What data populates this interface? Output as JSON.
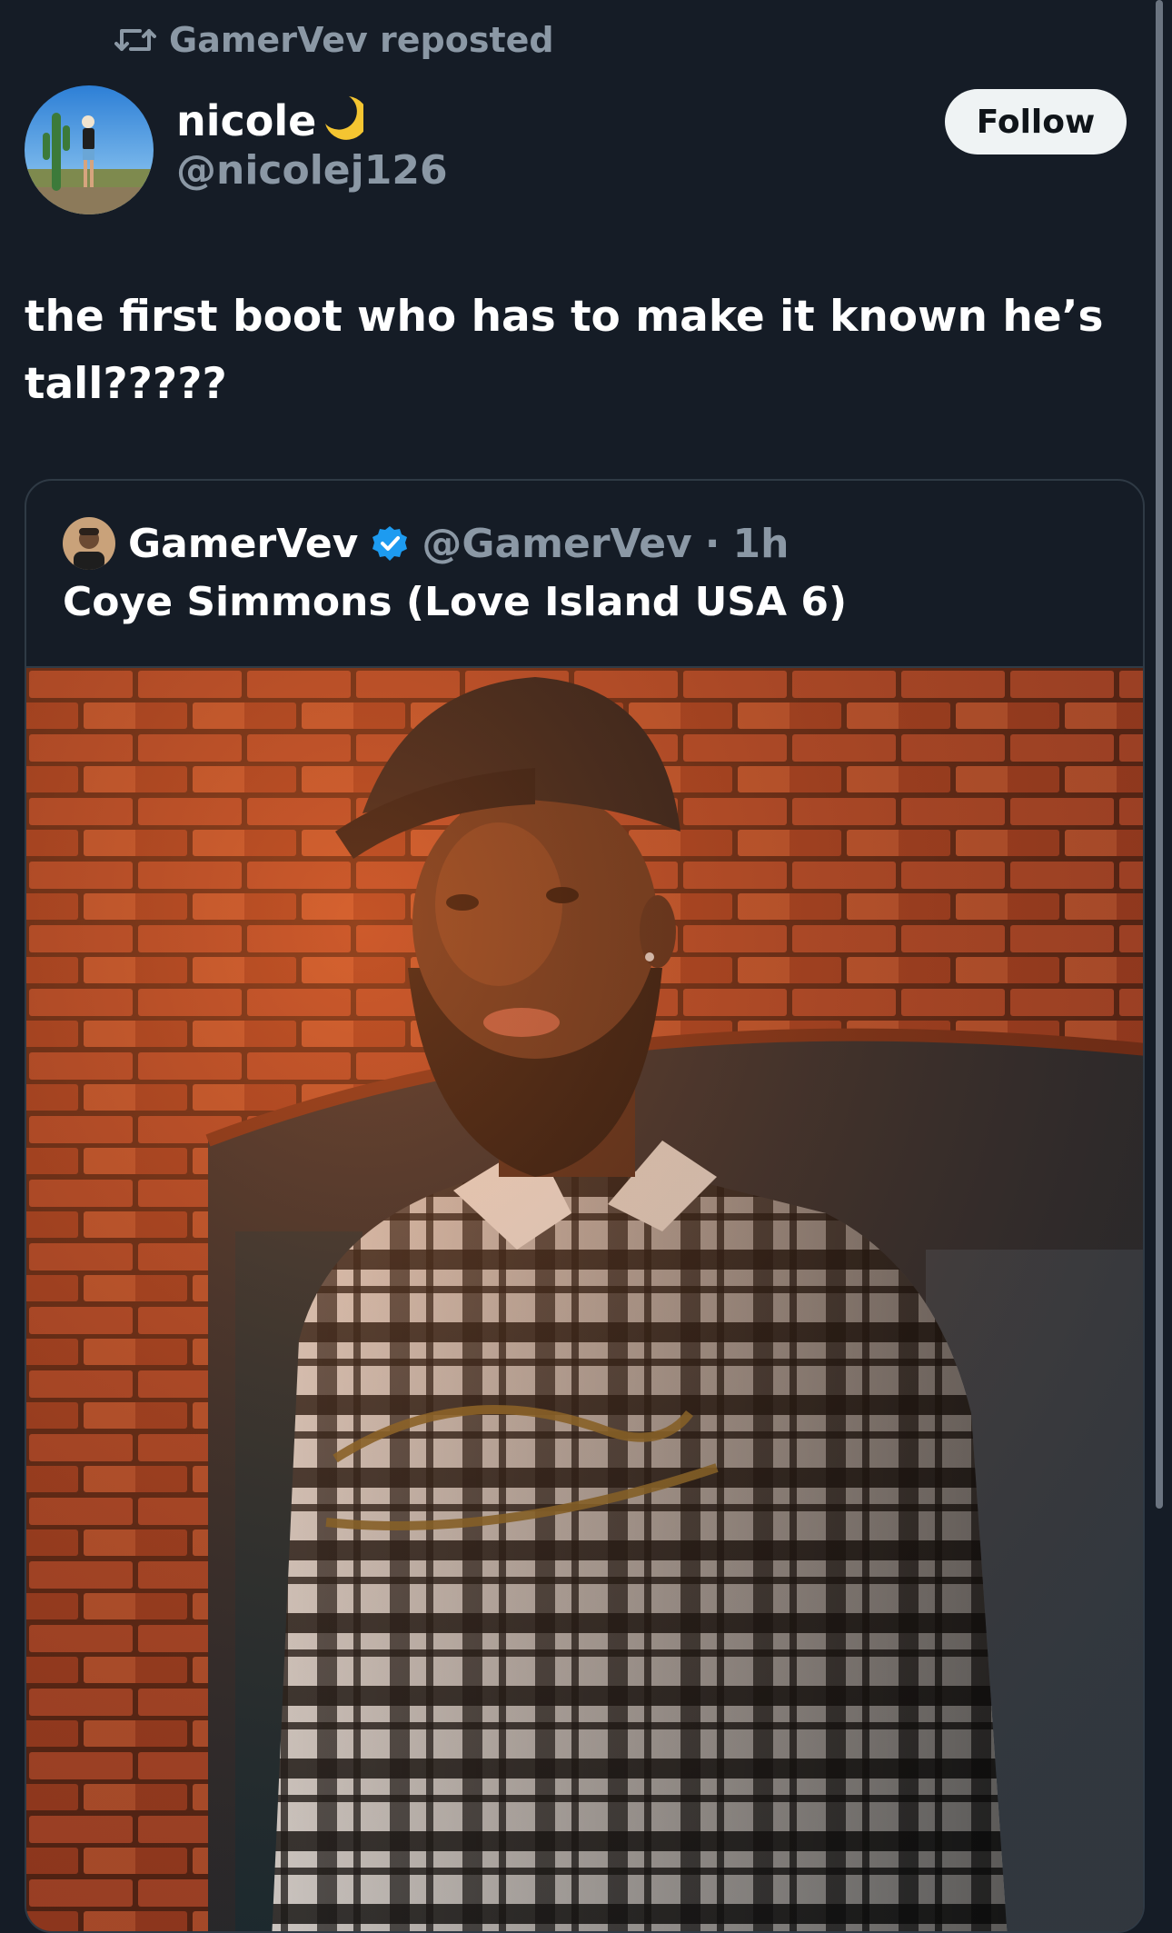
{
  "repost": {
    "label": "GamerVev reposted",
    "icon": "repost-icon"
  },
  "post": {
    "author": {
      "display_name": "nicole",
      "emoji": "🌙",
      "handle": "@nicolej126"
    },
    "follow_label": "Follow",
    "text": "the first boot who has to make it known he’s tall?????"
  },
  "quoted_post": {
    "author": {
      "display_name": "GamerVev",
      "verified": true,
      "handle": "@GamerVev",
      "separator": "·",
      "time": "1h"
    },
    "text": "Coye Simmons (Love Island USA 6)",
    "image": "photo of a bearded man in a black cap and a black-and-white plaid shirt standing in front of a red brick arch"
  },
  "colors": {
    "background": "#151c26",
    "text_primary": "#ffffff",
    "text_secondary": "#8b98a5",
    "verified_blue": "#1d9bf0",
    "follow_button_bg": "#eff3f4",
    "border": "#2f3a45"
  }
}
